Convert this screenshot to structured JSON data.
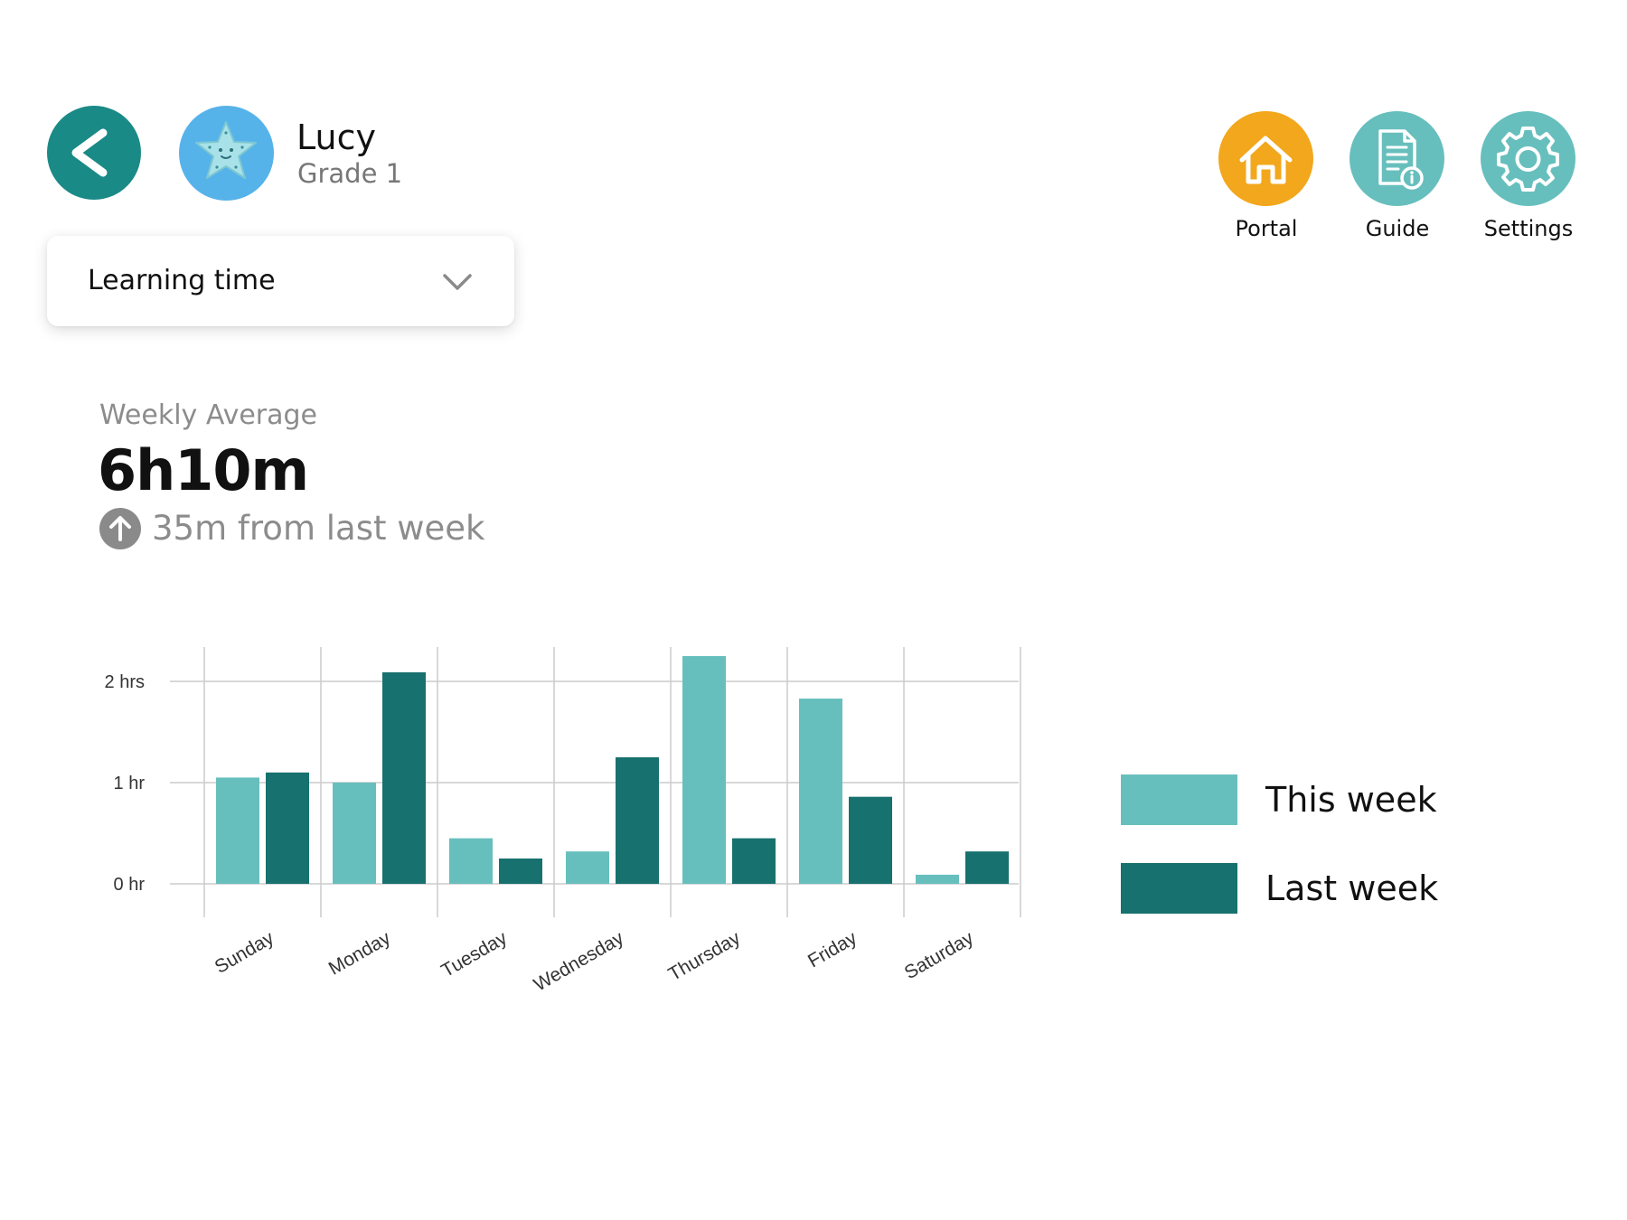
{
  "header": {
    "user_name": "Lucy",
    "user_grade": "Grade 1",
    "back_icon": "chevron-left-icon",
    "avatar_icon": "starfish-icon"
  },
  "metric_select": {
    "value": "Learning time",
    "icon": "chevron-down-icon"
  },
  "nav": [
    {
      "label": "Portal",
      "icon": "home-icon",
      "color": "#f2a71c"
    },
    {
      "label": "Guide",
      "icon": "document-info-icon",
      "color": "#67bfbd"
    },
    {
      "label": "Settings",
      "icon": "gear-icon",
      "color": "#67bfbd"
    }
  ],
  "summary": {
    "label": "Weekly Average",
    "value": "6h10m",
    "trend_icon": "arrow-up-icon",
    "trend_text": "35m from last week"
  },
  "colors": {
    "this_week": "#67bfbd",
    "last_week": "#17716e",
    "accent": "#1a8a87"
  },
  "chart_data": {
    "type": "bar",
    "categories": [
      "Sunday",
      "Monday",
      "Tuesday",
      "Wednesday",
      "Thursday",
      "Friday",
      "Saturday"
    ],
    "series": [
      {
        "name": "This week",
        "values": [
          1.05,
          1.0,
          0.45,
          0.32,
          2.25,
          1.83,
          0.09
        ]
      },
      {
        "name": "Last week",
        "values": [
          1.1,
          2.09,
          0.25,
          1.25,
          0.45,
          0.86,
          0.32
        ]
      }
    ],
    "ytick_labels": [
      "0 hr",
      "1 hr",
      "2 hrs"
    ],
    "ytick_values": [
      0,
      1,
      2
    ],
    "ylim": [
      0,
      2.3
    ],
    "grid": true,
    "legend": {
      "placement": "right",
      "labels": [
        "This week",
        "Last week"
      ]
    },
    "title": "",
    "xlabel": "",
    "ylabel": ""
  }
}
